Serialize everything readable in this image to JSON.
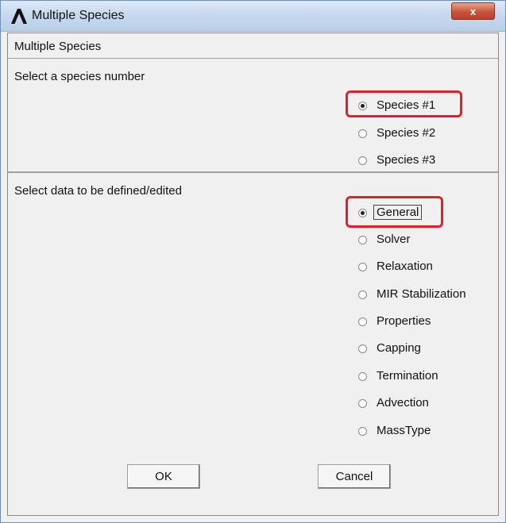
{
  "window": {
    "title": "Multiple Species",
    "logo_icon": "ansys-logo-icon",
    "close_label": "x"
  },
  "header": {
    "label": "Multiple Species"
  },
  "species_group": {
    "label": "Select a species number",
    "selected": "Species #1",
    "options": [
      "Species #1",
      "Species #2",
      "Species #3"
    ]
  },
  "data_group": {
    "label": "Select data to be defined/edited",
    "selected": "General",
    "options": [
      "General",
      "Solver",
      "Relaxation",
      "MIR Stabilization",
      "Properties",
      "Capping",
      "Termination",
      "Advection",
      "MassType"
    ]
  },
  "buttons": {
    "ok": "OK",
    "cancel": "Cancel"
  },
  "colors": {
    "highlight": "#e0212b",
    "title_bar": "#c5d8ee",
    "close_button": "#c9533a"
  }
}
